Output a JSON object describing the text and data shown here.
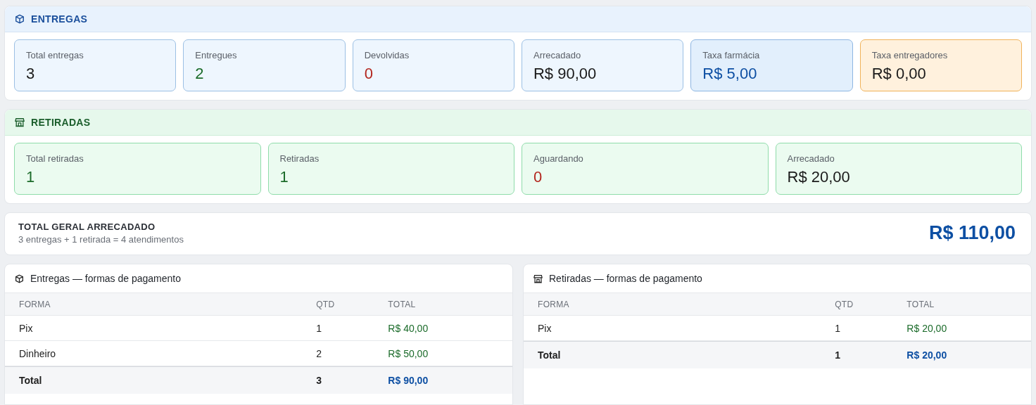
{
  "entregas": {
    "title": "ENTREGAS",
    "cards": [
      {
        "label": "Total entregas",
        "value": "3",
        "kind": "plain",
        "color": "#1a1a1a"
      },
      {
        "label": "Entregues",
        "value": "2",
        "kind": "plain",
        "color": "#1b6b2a"
      },
      {
        "label": "Devolvidas",
        "value": "0",
        "kind": "plain",
        "color": "#b3261e"
      },
      {
        "label": "Arrecadado",
        "value": "R$ 90,00",
        "kind": "plain",
        "color": "#1a1a1a"
      },
      {
        "label": "Taxa farmácia",
        "value": "R$ 5,00",
        "kind": "accent",
        "color": "#0d4fa3"
      },
      {
        "label": "Taxa entregadores",
        "value": "R$ 0,00",
        "kind": "warning",
        "color": "#1a1a1a"
      }
    ]
  },
  "retiradas": {
    "title": "RETIRADAS",
    "cards": [
      {
        "label": "Total retiradas",
        "value": "1",
        "kind": "success",
        "color": "#1b6b2a"
      },
      {
        "label": "Retiradas",
        "value": "1",
        "kind": "success",
        "color": "#1b6b2a"
      },
      {
        "label": "Aguardando",
        "value": "0",
        "kind": "success",
        "color": "#b3261e"
      },
      {
        "label": "Arrecadado",
        "value": "R$ 20,00",
        "kind": "success",
        "color": "#1a1a1a"
      }
    ]
  },
  "total": {
    "title": "TOTAL GERAL ARRECADADO",
    "subtitle": "3 entregas + 1 retirada = 4 atendimentos",
    "value": "R$ 110,00"
  },
  "tables": [
    {
      "title": "Entregas — formas de pagamento",
      "kind": "box",
      "columns": [
        "FORMA",
        "QTD",
        "TOTAL"
      ],
      "rows": [
        [
          "Pix",
          "1",
          "R$ 40,00"
        ],
        [
          "Dinheiro",
          "2",
          "R$ 50,00"
        ]
      ],
      "footer": [
        "Total",
        "3",
        "R$ 90,00"
      ]
    },
    {
      "title": "Retiradas — formas de pagamento",
      "kind": "store",
      "columns": [
        "FORMA",
        "QTD",
        "TOTAL"
      ],
      "rows": [
        [
          "Pix",
          "1",
          "R$ 20,00"
        ]
      ],
      "footer": [
        "Total",
        "1",
        "R$ 20,00"
      ]
    }
  ]
}
